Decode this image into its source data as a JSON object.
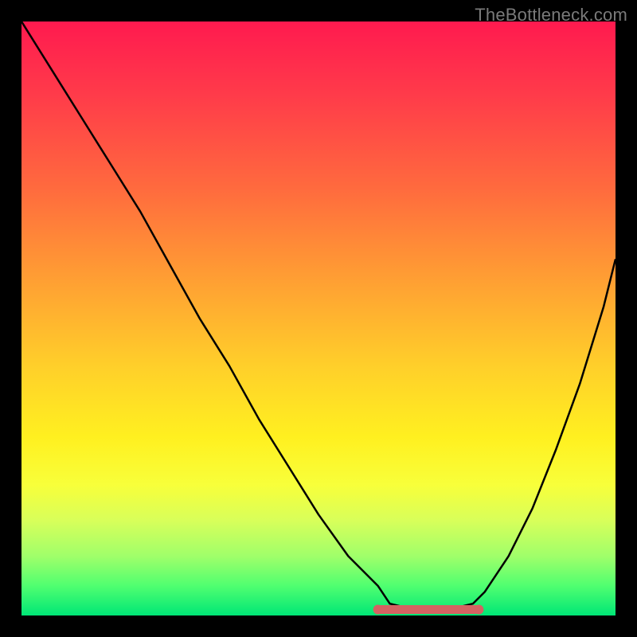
{
  "watermark": "TheBottleneck.com",
  "chart_data": {
    "type": "line",
    "title": "",
    "xlabel": "",
    "ylabel": "",
    "xlim": [
      0,
      100
    ],
    "ylim": [
      0,
      100
    ],
    "grid": false,
    "legend": false,
    "series": [
      {
        "name": "curve",
        "x": [
          0,
          5,
          10,
          15,
          20,
          25,
          30,
          35,
          40,
          45,
          50,
          55,
          60,
          62,
          66,
          72,
          76,
          78,
          82,
          86,
          90,
          94,
          98,
          100
        ],
        "y": [
          100,
          92,
          84,
          76,
          68,
          59,
          50,
          42,
          33,
          25,
          17,
          10,
          5,
          2,
          1,
          1,
          2,
          4,
          10,
          18,
          28,
          39,
          52,
          60
        ]
      }
    ],
    "highlight": {
      "name": "optimal-range",
      "x_start": 60,
      "x_end": 77,
      "y": 1
    },
    "colors": {
      "gradient_top": "#ff1a4f",
      "gradient_bottom": "#00e676",
      "curve": "#000000",
      "highlight": "#d46262"
    }
  }
}
